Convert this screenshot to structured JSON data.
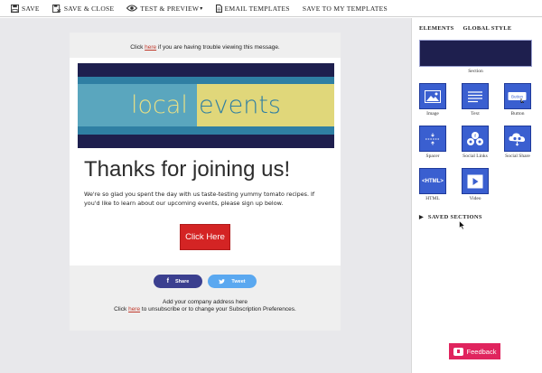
{
  "toolbar": {
    "save": "SAVE",
    "save_close": "SAVE & CLOSE",
    "test_preview": "TEST & PREVIEW",
    "email_templates": "EMAIL TEMPLATES",
    "save_to_templates": "SAVE TO MY TEMPLATES"
  },
  "email": {
    "top_prefix": "Click",
    "top_link": "here",
    "top_suffix": "if you are having trouble viewing this message.",
    "banner_left": "local",
    "banner_right": "events",
    "headline": "Thanks for joining us!",
    "paragraph": "We're so glad you spent the day with us taste-testing yummy tomato recipes. If you'd like to learn about our upcoming events, please sign up below.",
    "cta": "Click Here",
    "share": "Share",
    "tweet": "Tweet",
    "address": "Add your company address here",
    "unsub_prefix": "Click",
    "unsub_link": "here",
    "unsub_suffix": "to unsubscribe or to change your Subscription Preferences."
  },
  "panel": {
    "tabs": [
      "ELEMENTS",
      "GLOBAL STYLE"
    ],
    "section_label": "Section",
    "elements": [
      {
        "label": "Image",
        "icon": "image-icon"
      },
      {
        "label": "Text",
        "icon": "text-icon"
      },
      {
        "label": "Button",
        "icon": "button-icon"
      },
      {
        "label": "Spacer",
        "icon": "spacer-icon"
      },
      {
        "label": "Social Links",
        "icon": "social-links-icon"
      },
      {
        "label": "Social Share",
        "icon": "social-share-icon"
      },
      {
        "label": "HTML",
        "icon": "html-icon"
      },
      {
        "label": "Video",
        "icon": "video-icon"
      }
    ],
    "saved_sections": "SAVED SECTIONS",
    "tile_button_text": "Button",
    "tile_html_text": "<HTML>"
  },
  "feedback": "Feedback",
  "colors": {
    "banner_navy": "#1e1f4e",
    "banner_teal": "#2f7fa3",
    "banner_yellow": "#e0d77a",
    "cta_red": "#d42424",
    "share_blue": "#3b3f8f",
    "tweet_blue": "#5aa8f0",
    "tile_blue": "#3a5fd0",
    "feedback_pink": "#e0245e"
  }
}
